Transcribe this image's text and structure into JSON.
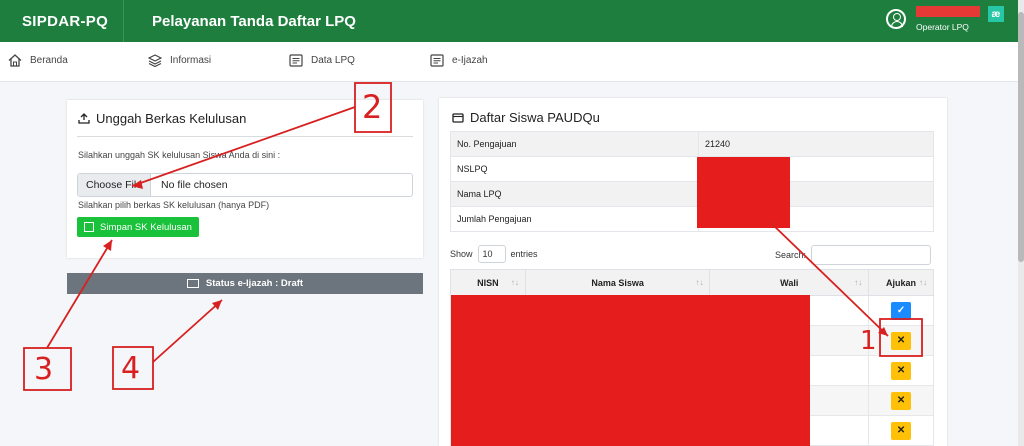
{
  "app": {
    "brand": "SIPDAR-PQ",
    "title": "Pelayanan Tanda Daftar LPQ"
  },
  "user": {
    "role": "Operator LPQ",
    "badge": "æ"
  },
  "nav": [
    {
      "label": "Beranda",
      "icon": "home-icon"
    },
    {
      "label": "Informasi",
      "icon": "layers-icon"
    },
    {
      "label": "Data LPQ",
      "icon": "list-icon"
    },
    {
      "label": "e-Ijazah",
      "icon": "list-icon"
    }
  ],
  "upload": {
    "title": "Unggah Berkas Kelulusan",
    "help1": "Silahkan unggah SK kelulusan Siswa Anda di sini :",
    "choose_label": "Choose File",
    "file_status": "No file chosen",
    "help2": "Silahkan pilih berkas SK kelulusan (hanya PDF)",
    "save_label": "Simpan SK Kelulusan"
  },
  "status": {
    "label": "Status e-Ijazah : Draft"
  },
  "siswa": {
    "title": "Daftar Siswa PAUDQu",
    "info": [
      {
        "label": "No. Pengajuan",
        "value": "21240"
      },
      {
        "label": "NSLPQ",
        "value": ""
      },
      {
        "label": "Nama LPQ",
        "value": ""
      },
      {
        "label": "Jumlah Pengajuan",
        "value": ""
      }
    ],
    "show_label": "Show",
    "show_value": "10",
    "entries_label": "entries",
    "search_label": "Search:",
    "columns": [
      "NISN",
      "Nama Siswa",
      "Wali",
      "Ajukan"
    ],
    "rows": [
      {
        "ajukan": "approved"
      },
      {
        "ajukan": "pending"
      },
      {
        "ajukan": "pending"
      },
      {
        "ajukan": "pending"
      },
      {
        "ajukan": "pending"
      }
    ]
  },
  "annotations": [
    "1",
    "2",
    "3",
    "4"
  ],
  "colors": {
    "header": "#1e7e3e",
    "save": "#19c23a",
    "annotation": "#d82020",
    "redaction": "#e51d1d",
    "check": "#1a8cff",
    "cross": "#ffc107"
  }
}
